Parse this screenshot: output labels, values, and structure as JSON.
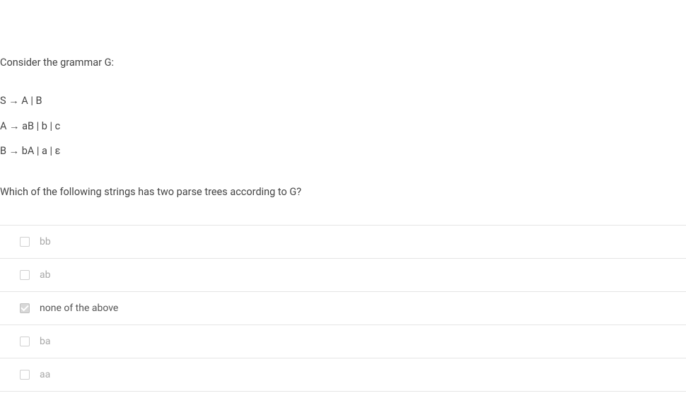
{
  "question": {
    "intro": "Consider the grammar G:",
    "rules": [
      "S → A | B",
      "A → aB | b | c",
      "B → bA | a | ε"
    ],
    "followup": "Which of the following strings has two parse trees according to G?"
  },
  "options": [
    {
      "label": "bb",
      "checked": false
    },
    {
      "label": "ab",
      "checked": false
    },
    {
      "label": "none of the above",
      "checked": true
    },
    {
      "label": "ba",
      "checked": false
    },
    {
      "label": "aa",
      "checked": false
    }
  ]
}
